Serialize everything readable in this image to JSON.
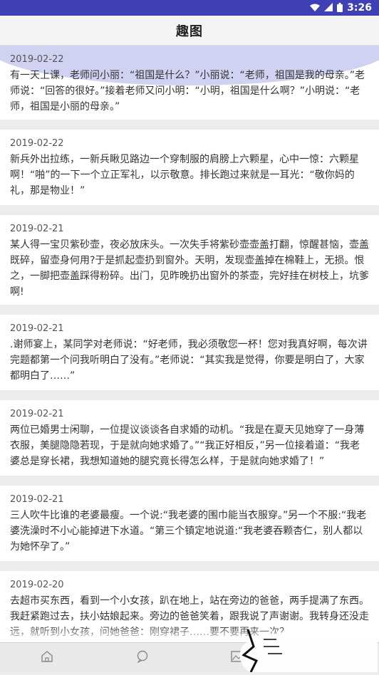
{
  "status_bar": {
    "time": "3:26",
    "icons": [
      "wifi-icon",
      "signal-icon",
      "battery-icon"
    ]
  },
  "header": {
    "title": "趣图"
  },
  "feed": {
    "items": [
      {
        "date": "2019-02-22",
        "text": "有一天上课，老师问小丽：“祖国是什么？”小丽说：“老师，祖国是我的母亲。”老师说：“回答的很好。”接着老师又问小明：“小明，祖国是什么啊？”小明说：“老师，祖国是小丽的母亲。”"
      },
      {
        "date": "2019-02-22",
        "text": "新兵外出拉练，一新兵瞅见路边一个穿制服的肩膀上六颗星，心中一惊：六颗星啊！“啪”的一下一个立正军礼，以示敬意。排长跑过来就是一耳光：“敬你妈的礼，那是物业！”"
      },
      {
        "date": "2019-02-21",
        "text": "某人得一宝贝紫砂壶，夜必放床头。一次失手将紫砂壶壶盖打翻，惊醒甚恼，壶盖既碎，留壶身何用?于是抓起壶扔到窗外。天明，发现壶盖掉在棉鞋上，无损。恨之，一脚把壶盖踩得粉碎。出门，见昨晚扔出窗外的茶壶，完好挂在树枝上，坑爹啊!"
      },
      {
        "date": "2019-02-21",
        "text": ".谢师宴上，某同学对老师说：“好老师，我必须敬您一杯！您对我真好啊，每次讲完题都第一个问我听明白了没有。”老师说：“其实我是觉得，你要是明白了，大家都明白了……”"
      },
      {
        "date": "2019-02-21",
        "text": "两位已婚男士闲聊，一位提议谈谈各自求婚的动机。“我是在夏天见她穿了一身薄衣服，美腿隐隐若现，于是就向她求婚了。”“我正好相反，”另一位接着道：“我老婆总是穿长裙，我想知道她的腿究竟长得怎么样，于是就向她求婚了！”"
      },
      {
        "date": "2019-02-21",
        "text": "三人吹牛比谁的老婆最瘦。一个说:“我老婆的围巾能当衣服穿。”另一个不服:“我老婆洗澡时不小心能掉进下水道。“第三个镇定地说道:“我老婆吞颗杏仁，别人都以为她怀孕了。”"
      },
      {
        "date": "2019-02-20",
        "text": "去超市买东西，看到一个小女孩，趴在地上，站在旁边的爸爸，两手提满了东西。我赶紧跑过去，扶小姑娘起来。旁边的爸爸笑着，跟我说了声谢谢。我转身还没走远，就听到小女孩，问她爸爸：刚穿裙子……要不要再来一次？"
      }
    ]
  },
  "bottom_nav": {
    "items": [
      "home-icon",
      "chat-icon",
      "image-icon"
    ]
  }
}
